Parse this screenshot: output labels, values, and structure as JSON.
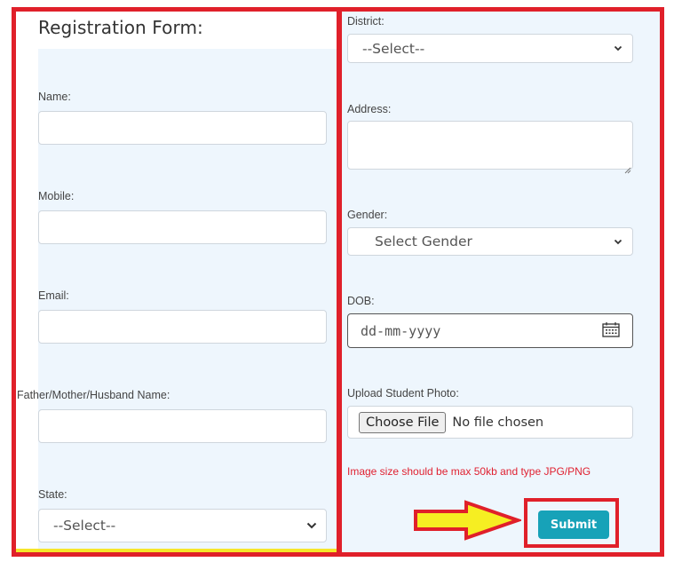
{
  "form": {
    "title": "Registration Form:"
  },
  "left_fields": {
    "name": {
      "label": "Name:",
      "value": "",
      "placeholder": ""
    },
    "mobile": {
      "label": "Mobile:",
      "value": "",
      "placeholder": ""
    },
    "email": {
      "label": "Email:",
      "value": "",
      "placeholder": ""
    },
    "guardian": {
      "label": "Father/Mother/Husband Name:",
      "value": "",
      "placeholder": ""
    },
    "state": {
      "label": "State:",
      "selected": "--Select--"
    }
  },
  "right_fields": {
    "district": {
      "label": "District:",
      "selected": "--Select--"
    },
    "address": {
      "label": "Address:",
      "value": ""
    },
    "gender": {
      "label": "Gender:",
      "selected": "Select Gender"
    },
    "dob": {
      "label": "DOB:",
      "placeholder": "dd-mm-yyyy",
      "icon": "calendar-icon"
    },
    "photo": {
      "label": "Upload Student Photo:",
      "button_label": "Choose File",
      "status": "No file chosen"
    },
    "photo_hint": "Image size should be max 50kb and type JPG/PNG"
  },
  "actions": {
    "submit_label": "Submit"
  },
  "annotations": {
    "highlight_color": "#e0202a",
    "arrow_color": "#f6ee22",
    "button_color": "#17a2b8"
  }
}
